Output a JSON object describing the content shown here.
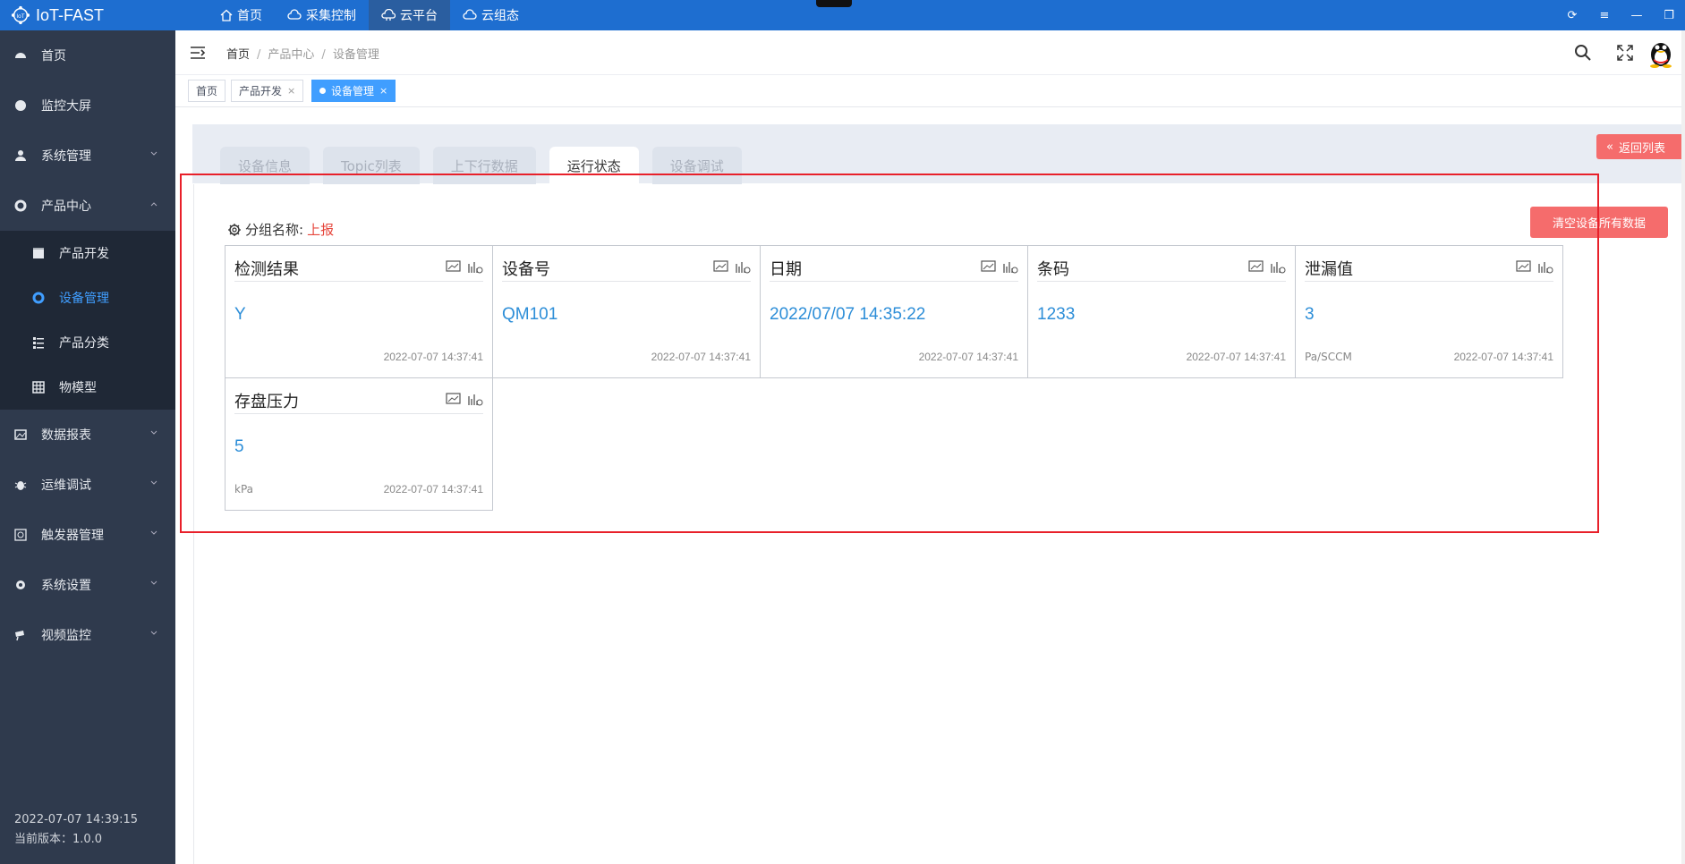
{
  "app": {
    "title": "IoT-FAST"
  },
  "topnav": [
    {
      "label": "首页",
      "icon": "home-icon"
    },
    {
      "label": "采集控制",
      "icon": "cloud-gear-icon"
    },
    {
      "label": "云平台",
      "icon": "cloud-building-icon",
      "active": true
    },
    {
      "label": "云组态",
      "icon": "cloud-icon"
    }
  ],
  "sidebar": {
    "items": [
      {
        "label": "首页"
      },
      {
        "label": "监控大屏"
      },
      {
        "label": "系统管理"
      },
      {
        "label": "产品中心"
      },
      {
        "label": "数据报表"
      },
      {
        "label": "运维调试"
      },
      {
        "label": "触发器管理"
      },
      {
        "label": "系统设置"
      },
      {
        "label": "视频监控"
      }
    ],
    "sub": [
      {
        "label": "产品开发"
      },
      {
        "label": "设备管理",
        "active": true
      },
      {
        "label": "产品分类"
      },
      {
        "label": "物模型"
      }
    ],
    "footer_time": "2022-07-07 14:39:15",
    "footer_version": "当前版本：1.0.0"
  },
  "breadcrumb": [
    "首页",
    "产品中心",
    "设备管理"
  ],
  "tags": [
    {
      "label": "首页"
    },
    {
      "label": "产品开发"
    },
    {
      "label": "设备管理",
      "active": true
    }
  ],
  "tabs": [
    "设备信息",
    "Topic列表",
    "上下行数据",
    "运行状态",
    "设备调试"
  ],
  "active_tab": "运行状态",
  "back_label": "返回列表",
  "clear_label": "清空设备所有数据",
  "group": {
    "prefix": "分组名称:",
    "name": "上报"
  },
  "cards": [
    {
      "title": "检测结果",
      "value": "Y",
      "unit": "",
      "time": "2022-07-07 14:37:41"
    },
    {
      "title": "设备号",
      "value": "QM101",
      "unit": "",
      "time": "2022-07-07 14:37:41"
    },
    {
      "title": "日期",
      "value": "2022/07/07 14:35:22",
      "unit": "",
      "time": "2022-07-07 14:37:41"
    },
    {
      "title": "条码",
      "value": "1233",
      "unit": "",
      "time": "2022-07-07 14:37:41"
    },
    {
      "title": "泄漏值",
      "value": "3",
      "unit": "Pa/SCCM",
      "time": "2022-07-07 14:37:41"
    },
    {
      "title": "存盘压力",
      "value": "5",
      "unit": "kPa",
      "time": "2022-07-07 14:37:41"
    }
  ],
  "colors": {
    "topbar": "#1e6ed0",
    "sidebar": "#2f3a4d",
    "accent": "#409eff",
    "danger": "#f56c6c",
    "value": "#2d8ed8"
  }
}
